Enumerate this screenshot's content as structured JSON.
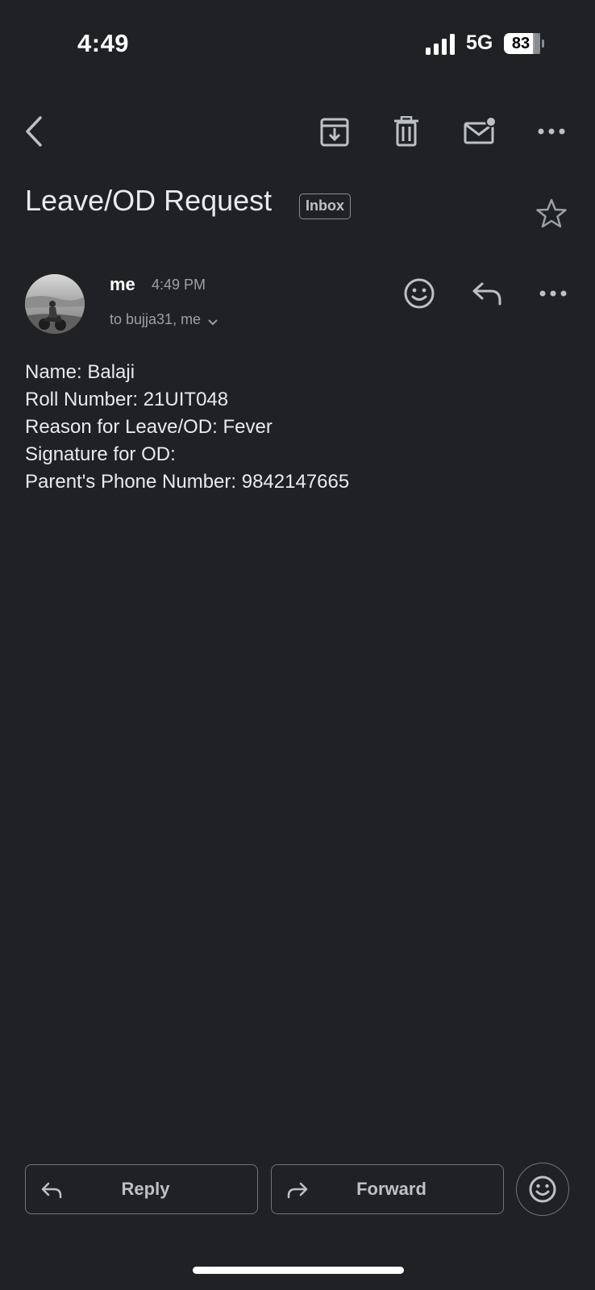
{
  "status_bar": {
    "time": "4:49",
    "network": "5G",
    "battery_level": "83",
    "signal_icon": "signal-bars-icon",
    "battery_icon": "battery-icon"
  },
  "toolbar": {
    "back_icon": "back-arrow-icon",
    "archive_icon": "archive-icon",
    "delete_icon": "trash-icon",
    "mark_unread_icon": "mark-unread-icon",
    "more_icon": "more-horizontal-icon"
  },
  "email": {
    "subject": "Leave/OD Request",
    "label": "Inbox",
    "starred": false,
    "sender": "me",
    "time": "4:49 PM",
    "recipients": "to bujja31, me",
    "body_lines": [
      "Name: Balaji",
      "Roll Number: 21UIT048",
      "Reason for Leave/OD: Fever",
      "Signature for OD:",
      "Parent's Phone Number: 9842147665"
    ]
  },
  "actions": {
    "reply_label": "Reply",
    "forward_label": "Forward"
  },
  "colors": {
    "background": "#202124",
    "text_primary": "#e8eaed",
    "text_secondary": "#9aa0a6",
    "icon": "#bdc1c6"
  }
}
